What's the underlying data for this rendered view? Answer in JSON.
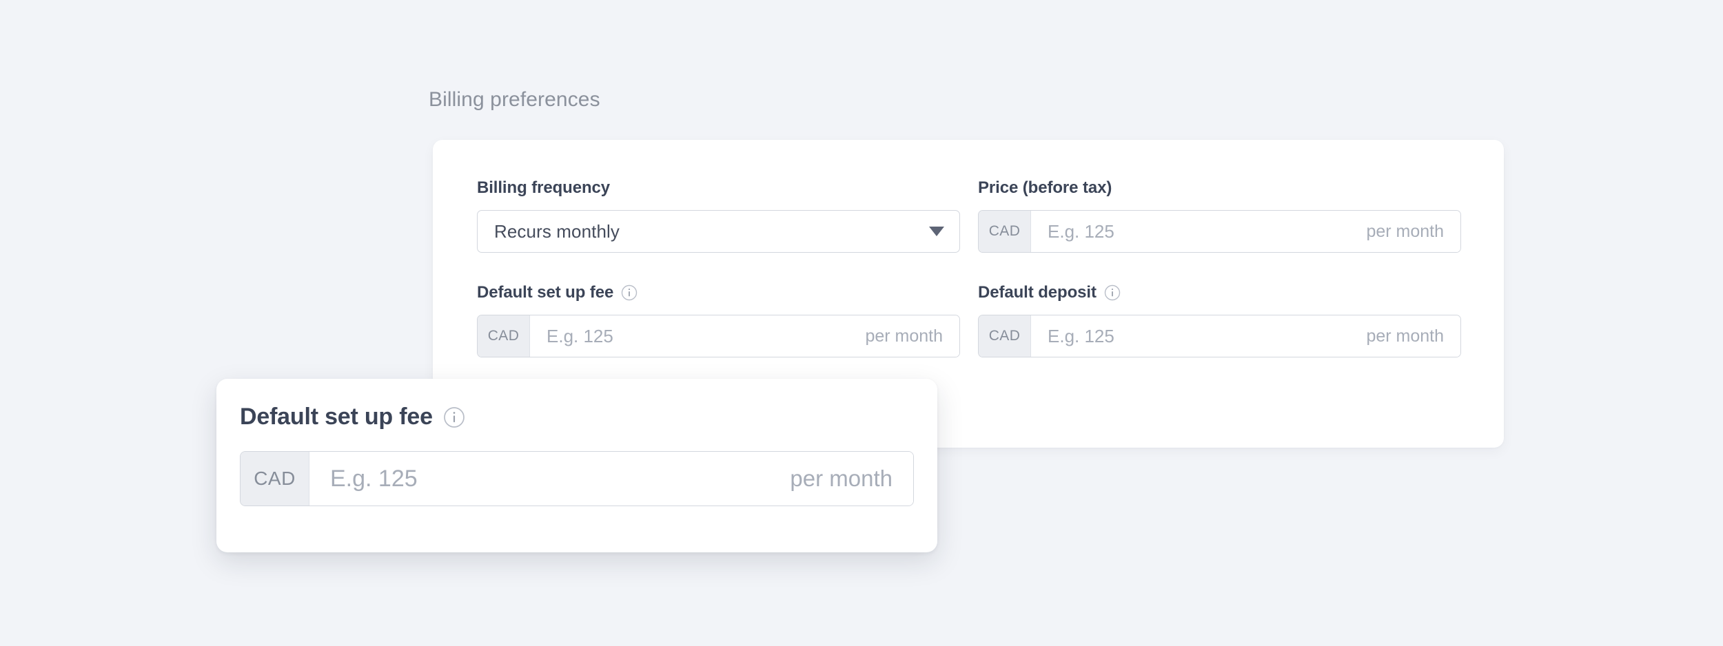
{
  "section": {
    "heading": "Billing preferences"
  },
  "form": {
    "billing_frequency": {
      "label": "Billing frequency",
      "value": "Recurs monthly",
      "caret_icon": "chevron-down-icon",
      "options": [
        "Recurs monthly"
      ]
    },
    "price_before_tax": {
      "label": "Price (before tax)",
      "currency": "CAD",
      "value": "",
      "placeholder": "E.g. 125",
      "suffix": "per month"
    },
    "default_set_up_fee": {
      "label": "Default set up fee",
      "info_icon": "info-circle-icon",
      "currency": "CAD",
      "value": "",
      "placeholder": "E.g. 125",
      "suffix": "per month"
    },
    "default_deposit": {
      "label": "Default deposit",
      "info_icon": "info-circle-icon",
      "currency": "CAD",
      "value": "",
      "placeholder": "E.g. 125",
      "suffix": "per month"
    }
  },
  "zoom_callout": {
    "label": "Default set up fee",
    "info_icon": "info-circle-icon",
    "currency": "CAD",
    "value": "",
    "placeholder": "E.g. 125",
    "suffix": "per month"
  },
  "colors": {
    "page_background": "#f2f4f8",
    "card_background": "#ffffff",
    "heading_text": "#8b919c",
    "label_text": "#3b4457",
    "placeholder_text": "#a7adb8",
    "input_border": "#d3d7de",
    "currency_chip_background": "#eceef2",
    "currency_chip_text": "#868d99",
    "caret_fill": "#5d6475"
  }
}
